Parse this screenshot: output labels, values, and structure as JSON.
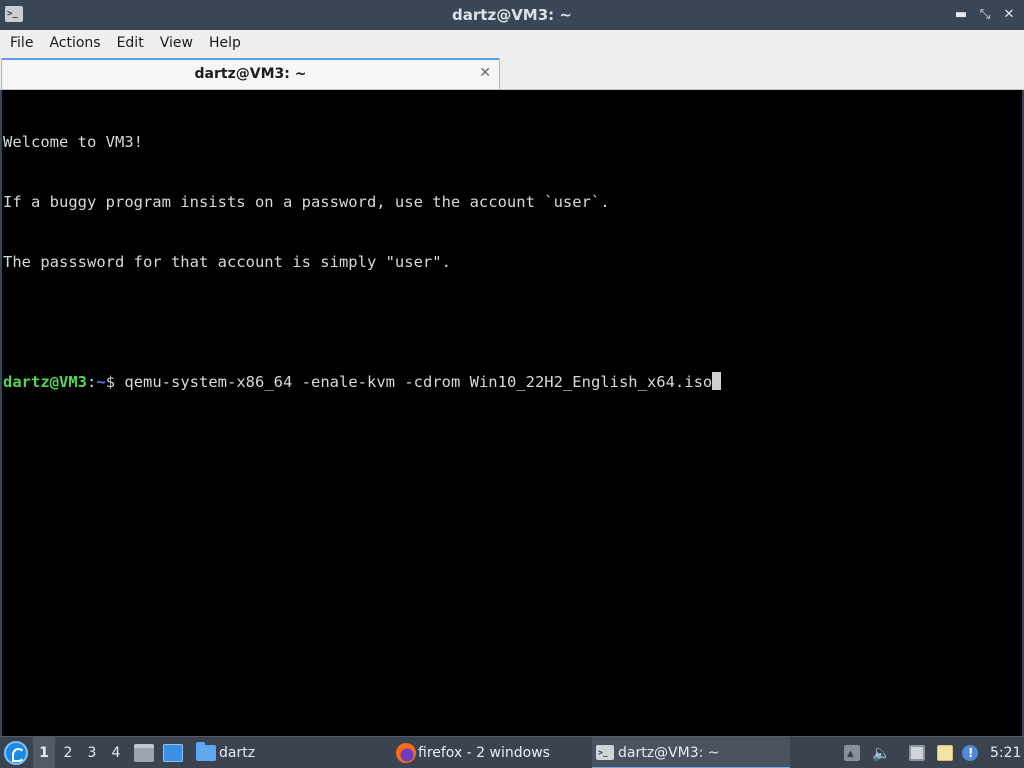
{
  "window": {
    "title": "dartz@VM3: ~",
    "icon": "terminal-icon",
    "controls": [
      "minimize-icon",
      "maximize-icon",
      "close-icon"
    ]
  },
  "menubar": {
    "items": [
      "File",
      "Actions",
      "Edit",
      "View",
      "Help"
    ]
  },
  "tabs": [
    {
      "label": "dartz@VM3: ~",
      "active": true
    }
  ],
  "terminal": {
    "lines": [
      "Welcome to VM3!",
      "If a buggy program insists on a password, use the account `user`.",
      "The passsword for that account is simply \"user\".",
      ""
    ],
    "prompt": {
      "user_host": "dartz@VM3",
      "separator": ":",
      "path": "~",
      "symbol": "$ ",
      "command": "qemu-system-x86_64 -enale-kvm -cdrom Win10_22H2_English_x64.iso"
    },
    "colors": {
      "background": "#000000",
      "text": "#d8d8d8",
      "prompt_user": "#55d455",
      "prompt_path": "#5b7ff0"
    }
  },
  "taskbar": {
    "workspaces": [
      "1",
      "2",
      "3",
      "4"
    ],
    "active_workspace": "1",
    "folder_label": "dartz",
    "tasks": [
      {
        "label": "firefox - 2 windows",
        "icon": "firefox-icon",
        "active": false
      },
      {
        "label": "dartz@VM3: ~",
        "icon": "terminal-icon",
        "active": true
      }
    ],
    "tray_icons": [
      "tray-arrow-icon",
      "volume-icon",
      "network-icon",
      "clipboard-icon",
      "notification-icon"
    ],
    "clock": "5:21"
  }
}
